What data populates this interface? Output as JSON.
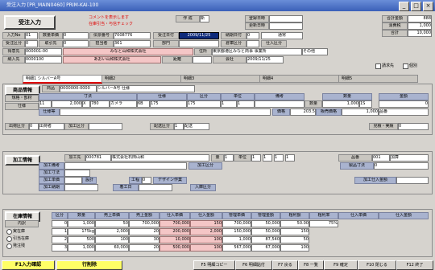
{
  "title": "受注入力 [PR_MAIN0460] PRIM-KAI-100",
  "header": {
    "heading": "受注入力",
    "note_line1": "コメントを表示します",
    "note_line2": "在庫引当・与信チェック",
    "sakusei_label": "作 成",
    "sakusei_value": "新",
    "touroku_label": "登録日時",
    "kousin_label": "更新日時",
    "amount_label1": "合計金額",
    "amount_value1": "888",
    "amount_label2": "消費税",
    "amount_value2": "1,000",
    "amount_label3": "合計",
    "amount_value3": "10,000"
  },
  "row1": {
    "nyuryoku_label": "入力No",
    "nyuryoku_value": "01",
    "kazu_label": "数量単価",
    "kazu_value": "0",
    "denpyo_label": "伝票番号",
    "denpyo_value": "7008776",
    "date_label": "受注日付",
    "date_value": "2009/11/25",
    "deadline_label": "納期日付",
    "deadline_value": "0",
    "kubun_value": "通常"
  },
  "row2": {
    "label1": "受注区分",
    "value1": "0",
    "label2": "取引先",
    "value2": "0",
    "label3": "担当者",
    "value3": "361",
    "label4": "部門",
    "label5": "倉庫区分",
    "label6": "仕入区分"
  },
  "row3": {
    "tokui_label": "得意先",
    "tokui_value": "000001-00",
    "tokui_name": "みなと山和株式会社",
    "juusho_label": "住所",
    "juusho_value": "東京都港区みなと商事 事業所",
    "juusho_extra": "その他"
  },
  "row4": {
    "nounyu_label": "納入先",
    "nounyu_value": "0000100",
    "nounyu_name": "あおい山和株式会社",
    "kyori_label": "距離",
    "kaisha_label": "会社",
    "kaisha_value": "2009/11/25"
  },
  "checks": {
    "c1": "請求先",
    "c2": "個別"
  },
  "tabs": [
    "明細1",
    "明細2",
    "明細3",
    "明細4",
    "明細5"
  ],
  "active_tab_label": "明細1 シルバーA号",
  "shouhin": {
    "heading": "商品情報",
    "code_label": "商品",
    "code_value": "00001",
    "code_extra": "0000000-0000",
    "name_value": "シルバーA号 仕様",
    "sub_heading1": "規格・部材",
    "sub_heading2": "仕様",
    "col_sunpo": "寸法",
    "col_shiyou": "仕様",
    "col_kubun": "区分",
    "col_tani": "単位",
    "col_bikou": "備考",
    "col_kazu": "数量",
    "col_kingaku": "金額",
    "row_vals": [
      "11",
      "2,000",
      "X",
      "780",
      "カメラ",
      "6B",
      "175",
      "175",
      "1",
      "1",
      "数量",
      "1,000",
      "1S",
      "0"
    ],
    "shiyou_label": "仕様等",
    "kakaku_label": "価格",
    "kakaku_value": "203.5",
    "hanbai_label": "販売価格",
    "hanbai_value": "1,000",
    "flag_value": "品番",
    "shukka_label": "出荷区分",
    "shukka_value": "0",
    "shukka_extra": "出荷者",
    "kako_label": "加工区分",
    "kako_value": "0",
    "haisou_label": "配送区分",
    "haisou_value": "1",
    "haisou_extra": "配送",
    "tokui_label": "得意先",
    "mitsumori_label": "見積・実績",
    "mitsumori_value": "0"
  },
  "kakou": {
    "heading": "加工情報",
    "code_label": "加工先",
    "code_value": "000781",
    "name_value": "株式会社石田山和",
    "ryou_label": "量",
    "ryou_value": "1",
    "tani_label": "単位",
    "tani_value": "1",
    "r1": "1",
    "r2": "1",
    "r3": "1",
    "hinban_label": "品番",
    "hinban_value": "001",
    "extra_value": "加算",
    "kakou_kubun": "加工区分",
    "label_bikou": "加工備考",
    "label_sunpo": "加工寸法",
    "label_seihin": "製品寸法",
    "seihin_value": "0",
    "label_kakaku": "加工単価",
    "label_sekkei": "設計",
    "label_kotei": "工程",
    "kotei_value": "0",
    "label_design": "デザイン作業",
    "label_nouki": "加工納期",
    "label_chakou": "着工日",
    "label_shiire": "加工仕入金額",
    "label_nyuko": "入庫区分"
  },
  "zaiko": {
    "heading": "在庫情報",
    "naikei_label": "内訳",
    "radio1": "実在庫",
    "radio2": "引当在庫",
    "radio3": "発注残",
    "kubun_label": "区分",
    "cols": [
      "区分",
      "数量",
      "売上単価",
      "売上金額",
      "仕入単価",
      "仕入金額",
      "管理単価",
      "管理金額",
      "粗利額",
      "粗利率",
      "仕入単価",
      "仕入金額"
    ],
    "row1": [
      "0",
      "1,000",
      "50",
      "700,000",
      "700,000",
      "150",
      "700,000",
      "50,000",
      "50.00",
      "75%"
    ],
    "row2": [
      "1",
      "175kg",
      "2,000",
      "20",
      "200,000",
      "2,000",
      "150,000",
      "50,000",
      "150"
    ],
    "row3": [
      "2",
      "500",
      "100",
      "30",
      "10,000",
      "100",
      "1,000",
      "87,540",
      "50"
    ],
    "row4": [
      "3",
      "1,000",
      "60,000",
      "20",
      "500,000",
      "100",
      "567,000",
      "67,000",
      "100"
    ]
  },
  "footer": {
    "btn_f1": "F1入力確認",
    "btn_f3": "行削除",
    "btn_f5": "F5 明細コピー",
    "btn_f6": "F6 明細貼付",
    "btn_f7": "F7 戻る",
    "btn_f8": "F8 一覧",
    "btn_f9": "F9 確定",
    "btn_f10": "F10 閉じる",
    "btn_f12": "F12 終了"
  }
}
